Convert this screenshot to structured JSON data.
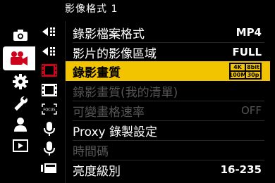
{
  "header": {
    "title": "影像格式 1"
  },
  "categories": [
    {
      "icon": "camera-icon",
      "active": false
    },
    {
      "icon": "video-camera-icon",
      "active": true
    },
    {
      "icon": "gear-icon",
      "active": false
    },
    {
      "icon": "wrench-icon",
      "active": false
    },
    {
      "icon": "person-icon",
      "active": false
    },
    {
      "icon": "playback-icon",
      "active": false
    }
  ],
  "menu": {
    "rows": [
      {
        "label": "錄影檔案格式",
        "value": "MP4",
        "state": "normal"
      },
      {
        "label": "影片的影像區域",
        "value": "FULL",
        "state": "normal"
      },
      {
        "label": "錄影畫質",
        "value": "",
        "state": "selected",
        "badge": {
          "tl": "4K",
          "tr": "8bit",
          "bl": "100M",
          "br": "30p"
        }
      },
      {
        "label": "錄影畫質(我的清單)",
        "value": "",
        "state": "disabled"
      },
      {
        "label": "可變畫格速率",
        "value": "OFF",
        "state": "disabled"
      },
      {
        "label": "Proxy 錄製設定",
        "value": "",
        "state": "normal"
      },
      {
        "label": "時間碼",
        "value": "",
        "state": "disabled"
      },
      {
        "label": "亮度級別",
        "value": "16-235",
        "state": "normal"
      }
    ]
  },
  "colors": {
    "accent": "#f2c400",
    "active_category": "#d0021b",
    "disabled": "#555555"
  }
}
